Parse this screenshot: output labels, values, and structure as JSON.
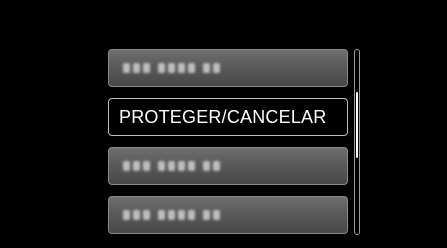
{
  "menu": {
    "items": [
      {
        "label": "",
        "selected": false
      },
      {
        "label": "PROTEGER/CANCELAR",
        "selected": true
      },
      {
        "label": "",
        "selected": false
      },
      {
        "label": "",
        "selected": false
      }
    ]
  },
  "scrollbar": {
    "position": 0.35
  },
  "colors": {
    "background": "#000000",
    "item_fill": "#5a5a5a",
    "selected_fill": "#000000",
    "text": "#ffffff"
  }
}
